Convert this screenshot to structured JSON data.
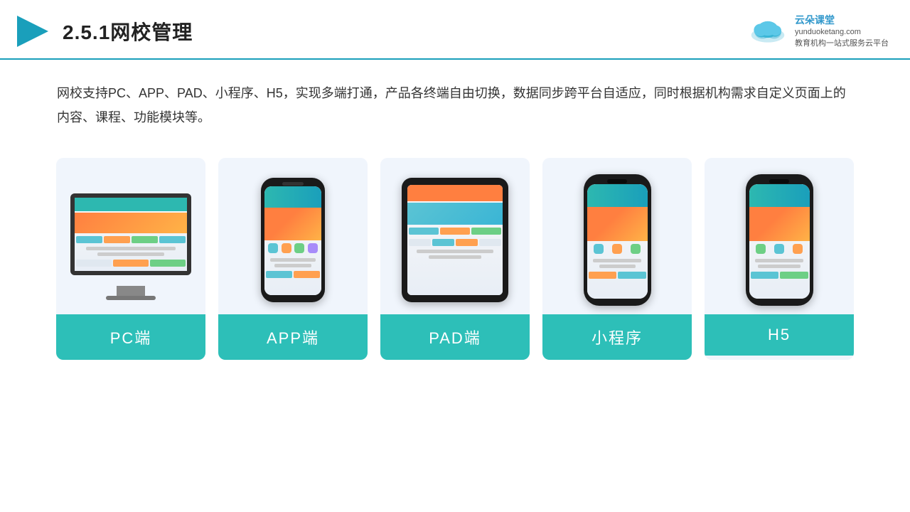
{
  "header": {
    "title": "2.5.1网校管理",
    "logo_name": "云朵课堂",
    "logo_url": "yunduoketang.com",
    "logo_tagline": "教育机构一站\n式服务云平台"
  },
  "description": "网校支持PC、APP、PAD、小程序、H5，实现多端打通，产品各终端自由切换，数据同步跨平台自适应，同时根据机构需求自定义页面上的内容、课程、功能模块等。",
  "cards": [
    {
      "id": "pc",
      "label": "PC端"
    },
    {
      "id": "app",
      "label": "APP端"
    },
    {
      "id": "pad",
      "label": "PAD端"
    },
    {
      "id": "miniprogram",
      "label": "小程序"
    },
    {
      "id": "h5",
      "label": "H5"
    }
  ],
  "accent_color": "#2dbfb8",
  "header_border_color": "#1a9fbb"
}
